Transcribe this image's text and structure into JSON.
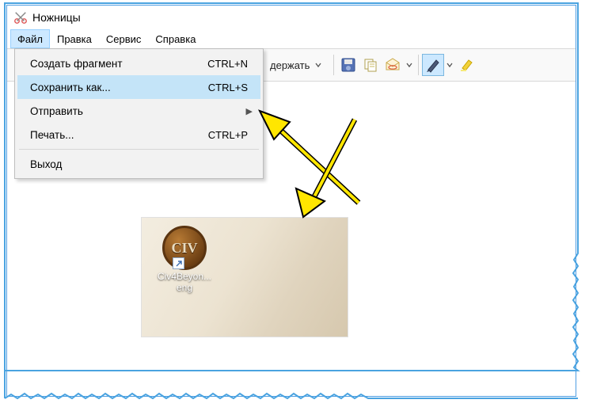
{
  "app": {
    "title": "Ножницы"
  },
  "menubar": {
    "items": [
      {
        "label": "Файл",
        "open": true
      },
      {
        "label": "Правка"
      },
      {
        "label": "Сервис"
      },
      {
        "label": "Справка"
      }
    ]
  },
  "dropdown": {
    "items": [
      {
        "label": "Создать фрагмент",
        "shortcut": "CTRL+N",
        "submenu": false
      },
      {
        "label": "Сохранить как...",
        "shortcut": "CTRL+S",
        "submenu": false,
        "hover": true
      },
      {
        "label": "Отправить",
        "shortcut": "",
        "submenu": true
      },
      {
        "label": "Печать...",
        "shortcut": "CTRL+P",
        "submenu": false
      },
      {
        "sep": true
      },
      {
        "label": "Выход",
        "shortcut": "",
        "submenu": false
      }
    ]
  },
  "toolbar": {
    "partial_button_text": "держать",
    "icons": [
      "save-icon",
      "copy-icon",
      "mail-icon",
      "pen-icon",
      "highlighter-icon"
    ]
  },
  "snip": {
    "icon_text": "CIV",
    "icon_label_line1": "Civ4Beyon...",
    "icon_label_line2": "eng"
  },
  "colors": {
    "highlight": "#c4e4f8",
    "border": "#509ee3",
    "jagged": "#4aa3e0"
  }
}
